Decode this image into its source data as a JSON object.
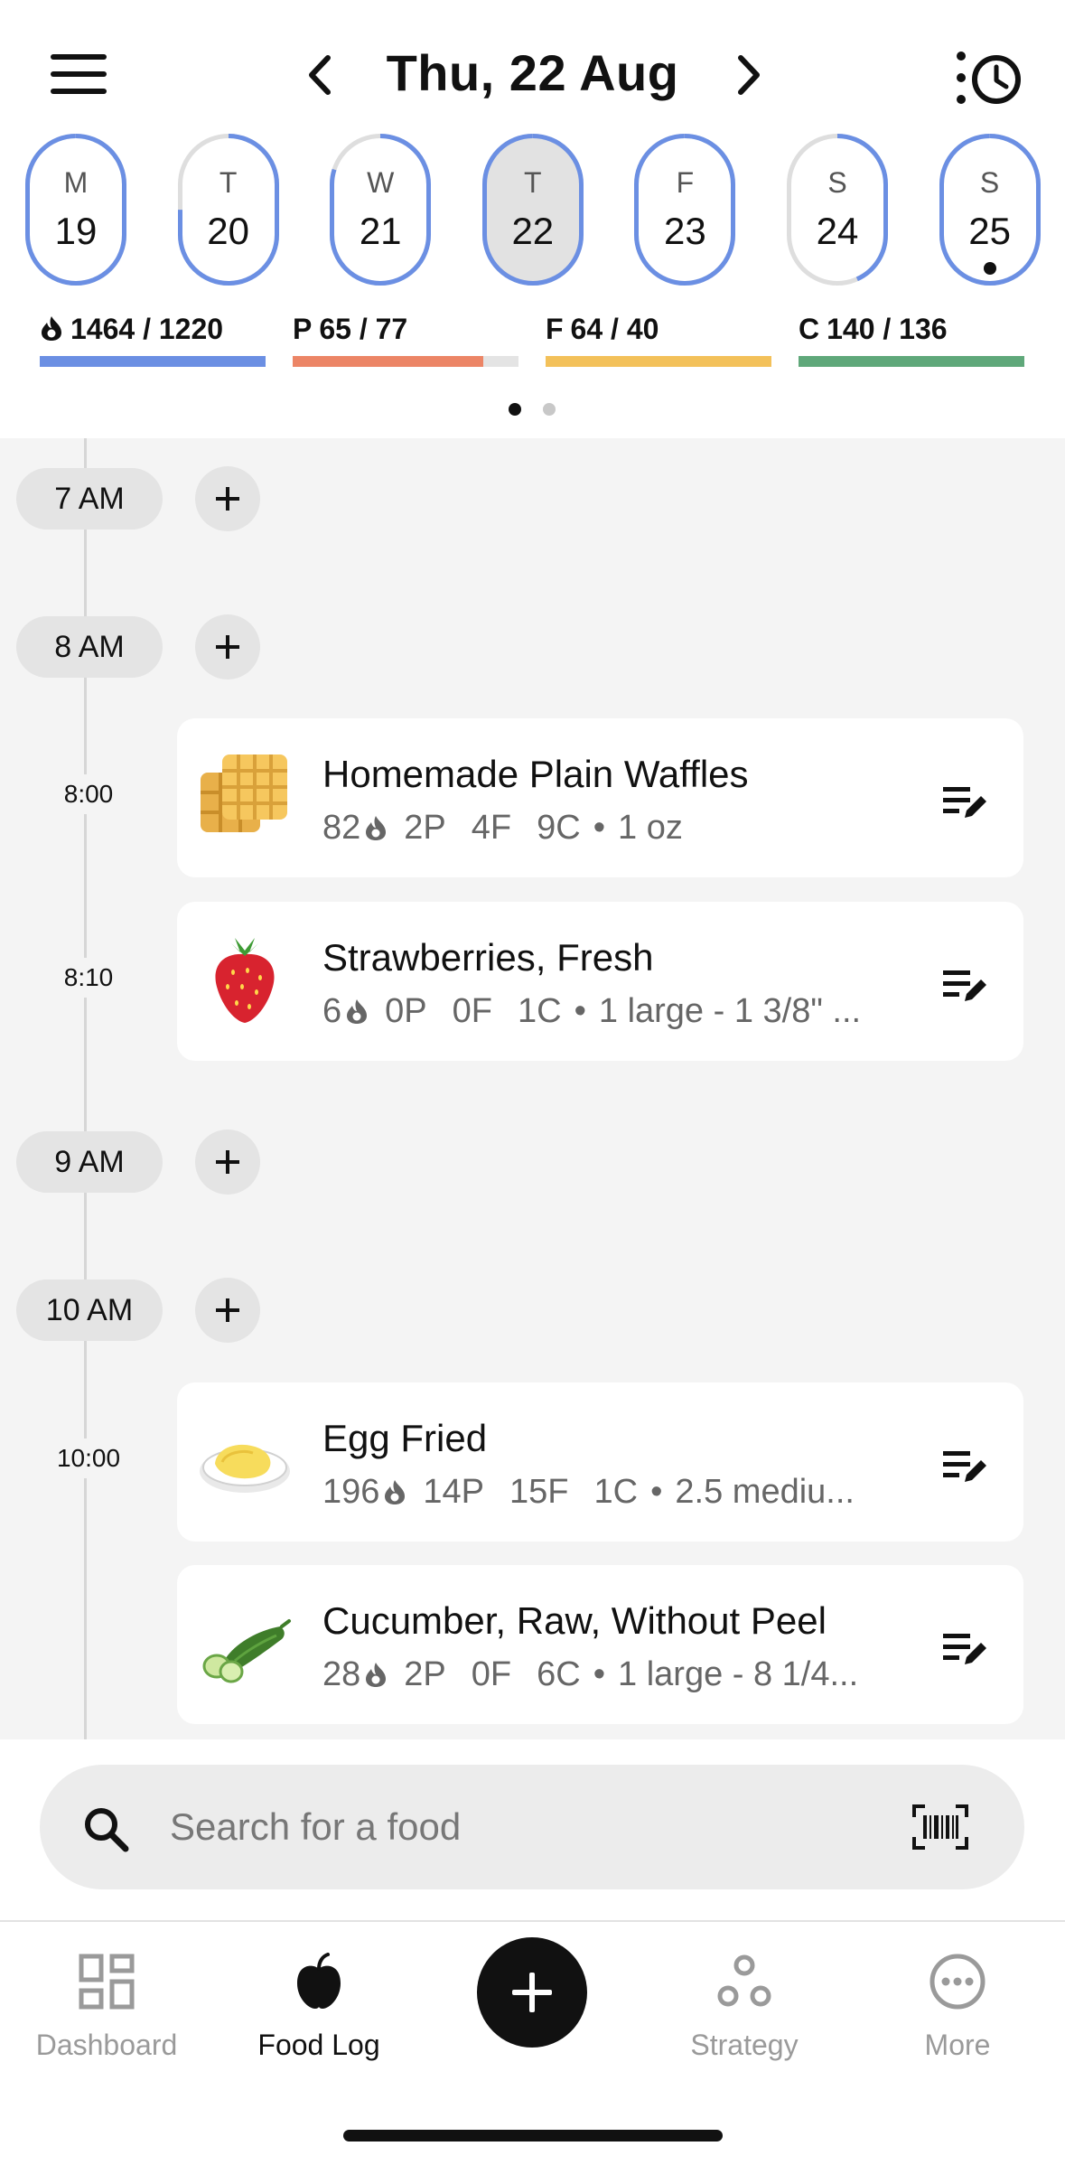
{
  "header": {
    "date_title": "Thu, 22 Aug"
  },
  "days": [
    {
      "letter": "M",
      "num": "19",
      "progress": 1.0,
      "selected": false,
      "dot": false
    },
    {
      "letter": "T",
      "num": "20",
      "progress": 0.75,
      "selected": false,
      "dot": false
    },
    {
      "letter": "W",
      "num": "21",
      "progress": 0.85,
      "selected": false,
      "dot": false
    },
    {
      "letter": "T",
      "num": "22",
      "progress": 1.0,
      "selected": true,
      "dot": false
    },
    {
      "letter": "F",
      "num": "23",
      "progress": 1.0,
      "selected": false,
      "dot": false
    },
    {
      "letter": "S",
      "num": "24",
      "progress": 0.45,
      "selected": false,
      "dot": false
    },
    {
      "letter": "S",
      "num": "25",
      "progress": 1.0,
      "selected": false,
      "dot": true
    }
  ],
  "macros": [
    {
      "key": "calories",
      "label": "",
      "value": "1464 / 1220",
      "fill": 1.0,
      "color": "#6b8fe3"
    },
    {
      "key": "protein",
      "label": "P",
      "value": "65 / 77",
      "fill": 0.844,
      "color": "#ec8566"
    },
    {
      "key": "fat",
      "label": "F",
      "value": "64 / 40",
      "fill": 1.0,
      "color": "#f3c15a"
    },
    {
      "key": "carbs",
      "label": "C",
      "value": "140 / 136",
      "fill": 1.0,
      "color": "#5fa87a"
    }
  ],
  "pager": {
    "count": 2,
    "active": 0
  },
  "timeline": {
    "hours": [
      "7 AM",
      "8 AM",
      "9 AM",
      "10 AM"
    ],
    "entries": [
      {
        "time": "8:00",
        "name": "Homemade Plain Waffles",
        "cal": "82",
        "protein": "2P",
        "fat": "4F",
        "carbs": "9C",
        "serving": "1 oz",
        "icon": "waffle-icon"
      },
      {
        "time": "8:10",
        "name": "Strawberries, Fresh",
        "cal": "6",
        "protein": "0P",
        "fat": "0F",
        "carbs": "1C",
        "serving": "1 large - 1 3/8\" ...",
        "icon": "strawberry-icon"
      },
      {
        "time": "10:00",
        "name": "Egg Fried",
        "cal": "196",
        "protein": "14P",
        "fat": "15F",
        "carbs": "1C",
        "serving": "2.5 mediu...",
        "icon": "fried-egg-icon"
      },
      {
        "time": "",
        "name": "Cucumber, Raw, Without Peel",
        "cal": "28",
        "protein": "2P",
        "fat": "0F",
        "carbs": "6C",
        "serving": "1 large - 8 1/4...",
        "icon": "cucumber-icon"
      }
    ]
  },
  "search": {
    "placeholder": "Search for a food"
  },
  "nav": {
    "dashboard": "Dashboard",
    "food_log": "Food Log",
    "strategy": "Strategy",
    "more": "More"
  },
  "colors": {
    "ring": "#6b8fe3",
    "ring_track": "#dedede",
    "selected_day_bg": "#e2e2e2"
  }
}
